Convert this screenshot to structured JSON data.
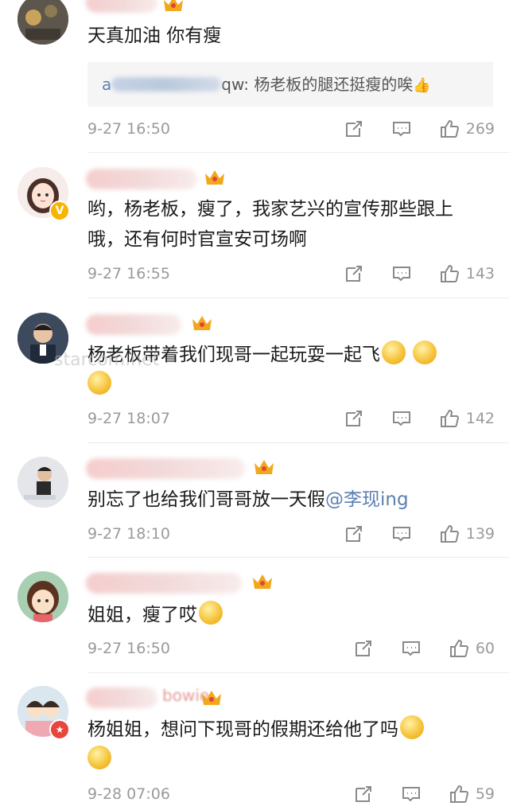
{
  "comments": [
    {
      "text": "天真加油  你有瘦",
      "quote_tail": "qw: 杨老板的腿还挺瘦的唉",
      "quote_emoji": "👍",
      "time": "9-27 16:50",
      "likes": "269"
    },
    {
      "text": "哟，杨老板，瘦了，我家艺兴的宣传那些跟上哦，还有何时官宣安可场啊",
      "time": "9-27 16:55",
      "likes": "143"
    },
    {
      "text": "杨老板带着我们现哥一起玩耍一起飞",
      "time": "9-27 18:07",
      "likes": "142"
    },
    {
      "text": "别忘了也给我们哥哥放一天假",
      "mention": "@李现ing",
      "time": "9-27 18:10",
      "likes": "139"
    },
    {
      "text": "姐姐，瘦了哎",
      "time": "9-27 16:50",
      "likes": "60"
    },
    {
      "text": "杨姐姐，想问下现哥的假期还给他了吗",
      "username_tail": "bowie",
      "time": "9-28 07:06",
      "likes": "59"
    }
  ],
  "watermark": "starcom.net",
  "colors": {
    "mention": "#5b7fb0",
    "meta": "#9a9a9a",
    "crown": "#f2a81d",
    "vip_badge": "#f7b500",
    "red_badge": "#e8453c"
  }
}
